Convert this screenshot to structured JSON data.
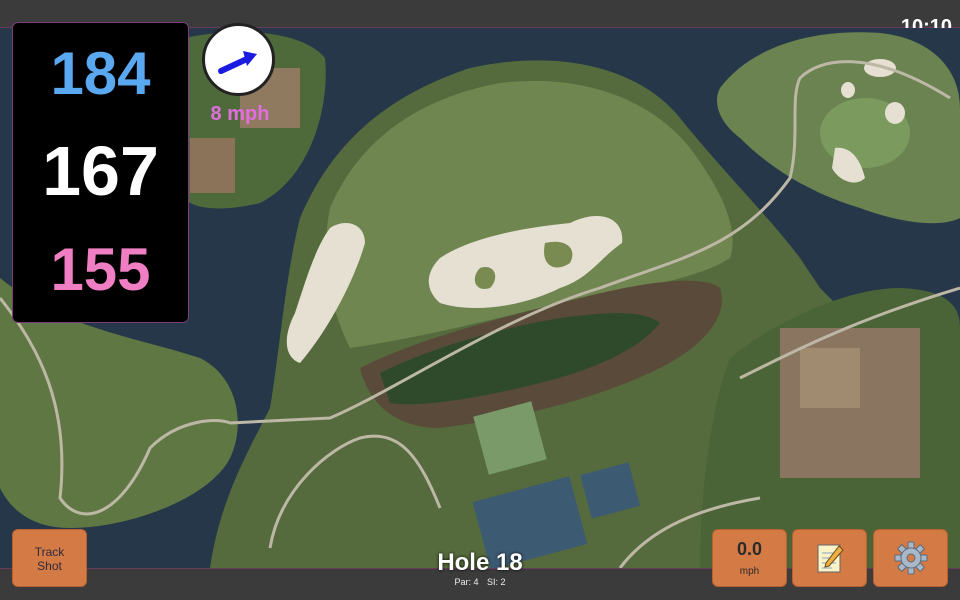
{
  "status": {
    "time": "10:10"
  },
  "distances": {
    "back": "184",
    "middle": "167",
    "front": "155"
  },
  "wind": {
    "speed_label": "8 mph",
    "icon": "wind-direction-arrow-icon"
  },
  "hole": {
    "title": "Hole 18",
    "par_label": "Par: 4",
    "si_label": "SI: 2"
  },
  "buttons": {
    "track_shot_line1": "Track",
    "track_shot_line2": "Shot",
    "speed_value": "0.0",
    "speed_unit": "mph",
    "notes_icon": "notepad-icon",
    "settings_icon": "gear-icon"
  },
  "colors": {
    "back_distance": "#5aa9f0",
    "middle_distance": "#ffffff",
    "front_distance": "#f07ec3",
    "wind_text": "#e26de0",
    "button": "#d47a45"
  }
}
